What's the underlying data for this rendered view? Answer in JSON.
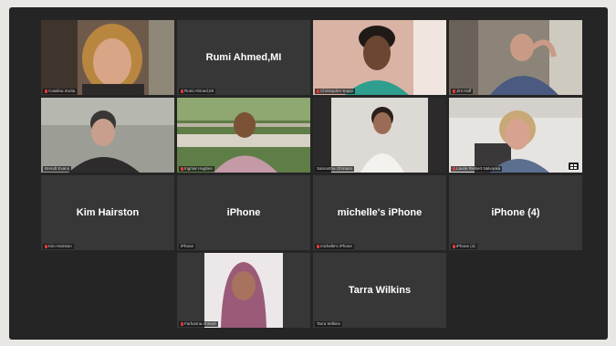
{
  "meeting": {
    "tiles": [
      {
        "id": "t1",
        "display_name": "",
        "label": "Catalina Zurita",
        "muted": true
      },
      {
        "id": "t2",
        "display_name": "Rumi Ahmed,MI",
        "label": "Rumi Ahmed,MI",
        "muted": true
      },
      {
        "id": "t3",
        "display_name": "",
        "label": "Christopher Koppi",
        "muted": true
      },
      {
        "id": "t4",
        "display_name": "",
        "label": "Jim Hoff",
        "muted": true
      },
      {
        "id": "t5",
        "display_name": "",
        "label": "Brendt Evans",
        "muted": false
      },
      {
        "id": "t6",
        "display_name": "",
        "label": "Ingmar Hughes",
        "muted": true
      },
      {
        "id": "t7",
        "display_name": "",
        "label": "Samantha Ohmann",
        "muted": false
      },
      {
        "id": "t8",
        "display_name": "",
        "label": "Laurie Reibert Nalvanka",
        "muted": true
      },
      {
        "id": "t9",
        "display_name": "Kim Hairston",
        "label": "Kim Hairston",
        "muted": true
      },
      {
        "id": "t10",
        "display_name": "iPhone",
        "label": "iPhone",
        "muted": false
      },
      {
        "id": "t11",
        "display_name": "michelle's iPhone",
        "label": "michelle's iPhone",
        "muted": true
      },
      {
        "id": "t12",
        "display_name": "iPhone (4)",
        "label": "iPhone (4)",
        "muted": true
      },
      {
        "id": "t13",
        "display_name": "",
        "label": "Farhanna Ahmed",
        "muted": true
      },
      {
        "id": "t14",
        "display_name": "Tarra Wilkins",
        "label": "Tarra Wilkins",
        "muted": false
      }
    ],
    "active_speaker": "t7",
    "colors": {
      "window_bg": "#252525",
      "tile_bg": "#373737",
      "active_border": "#b7e05a",
      "mute_icon": "#e23a3a"
    }
  }
}
